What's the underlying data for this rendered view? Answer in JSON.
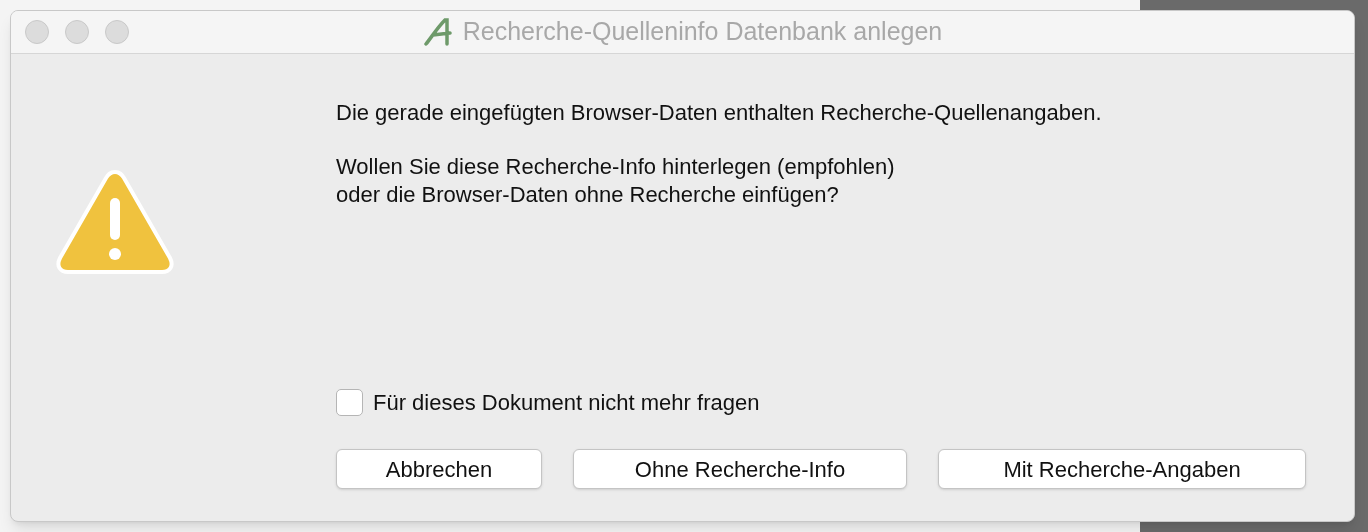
{
  "window": {
    "title": "Recherche-Quelleninfo Datenbank anlegen"
  },
  "message": {
    "lines": [
      "Die gerade eingefügten Browser-Daten enthalten Recherche-Quellenangaben.",
      "Wollen Sie diese Recherche-Info hinterlegen (empfohlen)\noder die Browser-Daten ohne Recherche einfügen?"
    ]
  },
  "checkbox": {
    "label": "Für dieses Dokument nicht mehr fragen",
    "checked": false
  },
  "buttons": [
    "Abbrechen",
    "Ohne Recherche-Info",
    "Mit Recherche-Angaben"
  ]
}
